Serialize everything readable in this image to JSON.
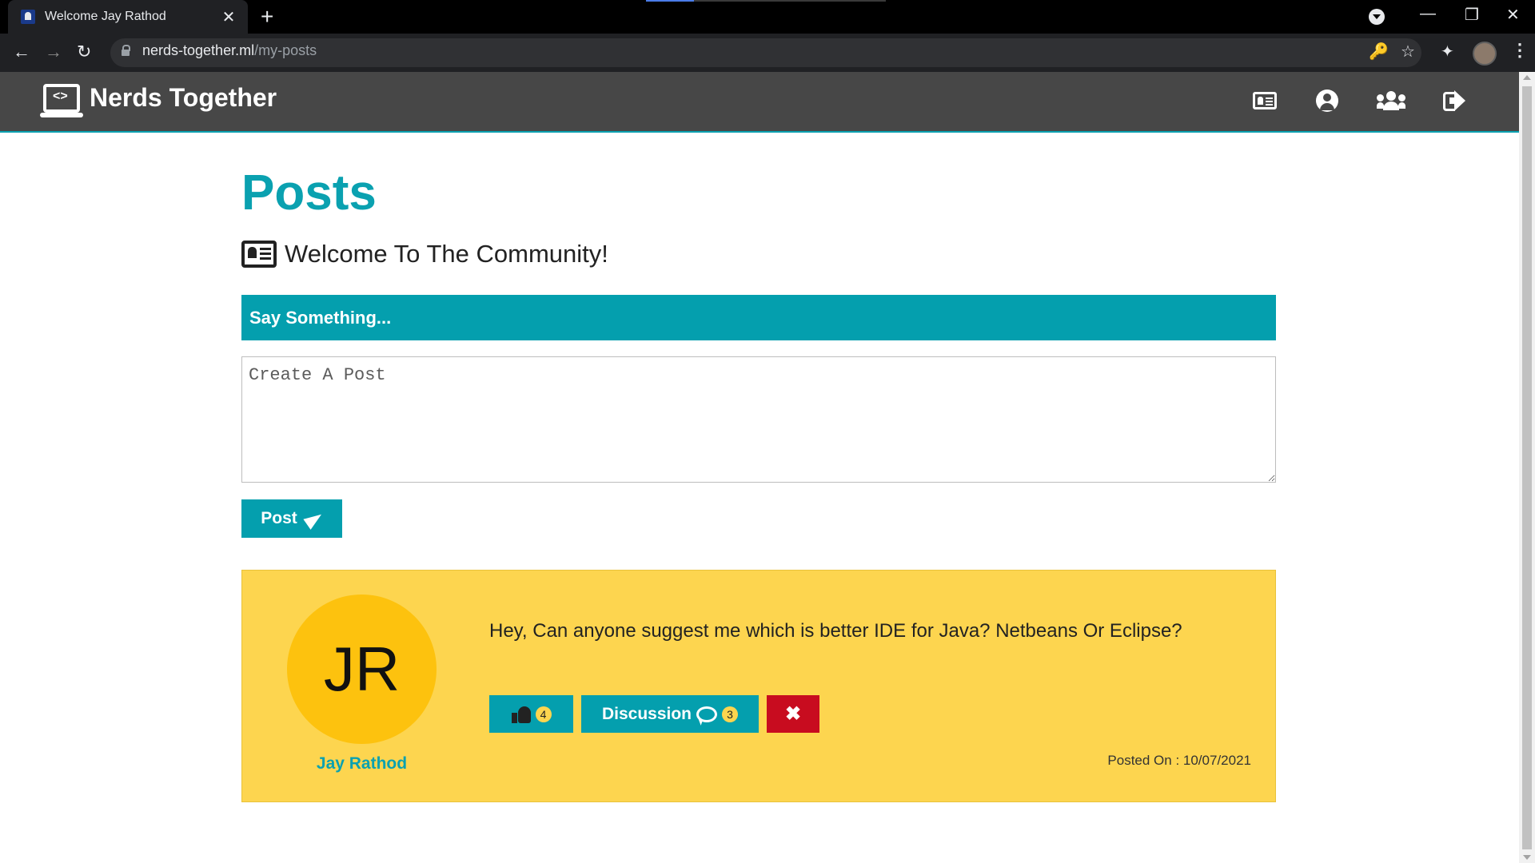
{
  "browser": {
    "tab_title": "Welcome Jay Rathod",
    "tab_close": "✕",
    "new_tab": "+",
    "url_domain": "nerds-together.ml",
    "url_path": "/my-posts",
    "back": "←",
    "forward": "→",
    "reload": "↻",
    "key_icon": "🔑",
    "star_icon": "☆",
    "ext_icon": "✦",
    "menu": "⋮",
    "minimize": "—",
    "maximize": "❐",
    "close": "✕"
  },
  "header": {
    "brand": "Nerds Together",
    "brand_icon_glyph": "<>",
    "icons": [
      "id-card-icon",
      "user-circle-icon",
      "users-icon",
      "sign-out-icon"
    ]
  },
  "main": {
    "title": "Posts",
    "welcome": "Welcome To The Community!",
    "say_something": "Say Something...",
    "post_placeholder": "Create A Post",
    "post_button": "Post"
  },
  "post": {
    "initials": "JR",
    "author": "Jay Rathod",
    "text": "Hey, Can anyone suggest me which is better IDE for Java? Netbeans Or Eclipse?",
    "likes": "4",
    "discussion_label": "Discussion",
    "comments": "3",
    "delete": "✖",
    "posted_on": "Posted On : 10/07/2021"
  },
  "colors": {
    "accent": "#049fae",
    "header_bg": "#474747",
    "card_bg": "#fdd54f",
    "avatar_bg": "#fdc20e",
    "danger": "#c80c1f"
  }
}
